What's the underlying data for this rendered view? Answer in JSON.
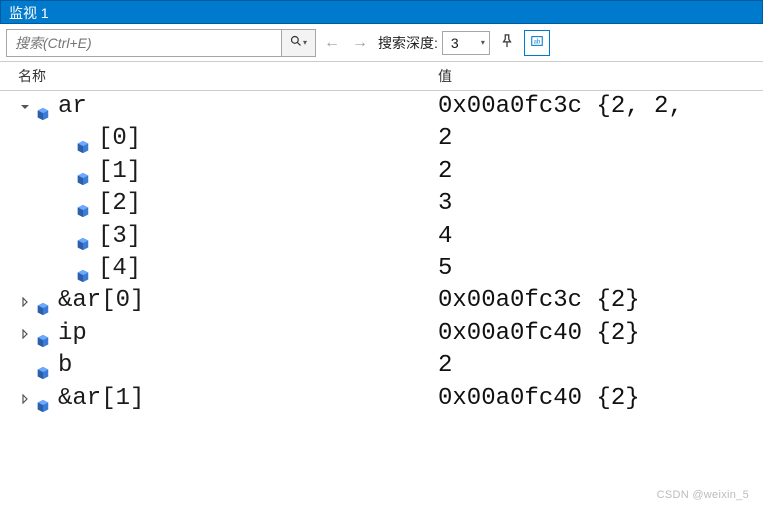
{
  "title": "监视 1",
  "toolbar": {
    "search_placeholder": "搜索(Ctrl+E)",
    "depth_label": "搜索深度:",
    "depth_value": "3"
  },
  "columns": {
    "name": "名称",
    "value": "值"
  },
  "rows": [
    {
      "indent": 1,
      "expander": "down",
      "icon": true,
      "name": "ar",
      "value": "0x00a0fc3c {2, 2,"
    },
    {
      "indent": 2,
      "expander": "none",
      "icon": true,
      "name": "[0]",
      "value": "2"
    },
    {
      "indent": 2,
      "expander": "none",
      "icon": true,
      "name": "[1]",
      "value": "2"
    },
    {
      "indent": 2,
      "expander": "none",
      "icon": true,
      "name": "[2]",
      "value": "3"
    },
    {
      "indent": 2,
      "expander": "none",
      "icon": true,
      "name": "[3]",
      "value": "4"
    },
    {
      "indent": 2,
      "expander": "none",
      "icon": true,
      "name": "[4]",
      "value": "5"
    },
    {
      "indent": 1,
      "expander": "right",
      "icon": true,
      "name": "&ar[0]",
      "value": "0x00a0fc3c {2}"
    },
    {
      "indent": 1,
      "expander": "right",
      "icon": true,
      "name": "ip",
      "value": "0x00a0fc40 {2}"
    },
    {
      "indent": 1,
      "expander": "none",
      "icon": true,
      "name": "b",
      "value": "2"
    },
    {
      "indent": 1,
      "expander": "right",
      "icon": true,
      "name": "&ar[1]",
      "value": "0x00a0fc40 {2}"
    }
  ],
  "watermark": "CSDN @weixin_5"
}
